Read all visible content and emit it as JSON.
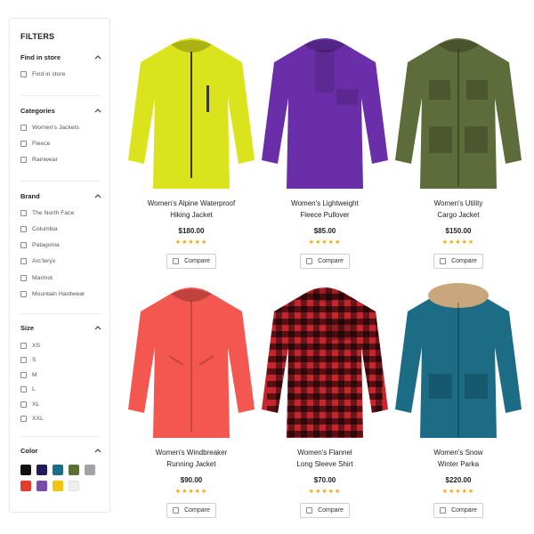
{
  "filters": {
    "title": "FILTERS",
    "find_in_store": {
      "title": "Find in store",
      "options": [
        "Find in store"
      ]
    },
    "categories": {
      "title": "Categories",
      "options": [
        "Women's Jackets",
        "Fleece",
        "Rainwear"
      ]
    },
    "brand": {
      "title": "Brand",
      "options": [
        "The North Face",
        "Columbia",
        "Patagonia",
        "Arc'teryx",
        "Marmot",
        "Mountain Hardwear"
      ]
    },
    "size": {
      "title": "Size",
      "options": [
        "XS",
        "S",
        "M",
        "L",
        "XL",
        "XXL"
      ]
    },
    "color": {
      "title": "Color",
      "swatches": [
        "#111111",
        "#241a5e",
        "#1a6e84",
        "#5b7133",
        "#a3a3a3",
        "#e53c32",
        "#7a4aa8",
        "#f2c416",
        "#eeeeee"
      ]
    }
  },
  "products": [
    {
      "name_line1": "Women's Alpine Waterproof",
      "name_line2": "Hiking Jacket",
      "price": "$180.00",
      "stars": "★★★★★",
      "compare_label": "Compare",
      "color": "#dbe31c"
    },
    {
      "name_line1": "Women's Lightweight",
      "name_line2": "Fleece Pullover",
      "price": "$85.00",
      "stars": "★★★★★",
      "compare_label": "Compare",
      "color": "#6a2fa8"
    },
    {
      "name_line1": "Women's Utility",
      "name_line2": "Cargo Jacket",
      "price": "$150.00",
      "stars": "★★★★★",
      "compare_label": "Compare",
      "color": "#5e6b3a"
    },
    {
      "name_line1": "Women's Windbreaker",
      "name_line2": "Running Jacket",
      "price": "$90.00",
      "stars": "★★★★★",
      "compare_label": "Compare",
      "color": "#f4574f"
    },
    {
      "name_line1": "Women's Flannel",
      "name_line2": "Long Sleeve Shirt",
      "price": "$70.00",
      "stars": "★★★★★",
      "compare_label": "Compare",
      "color": "#c8242b"
    },
    {
      "name_line1": "Women's Snow",
      "name_line2": "Winter Parka",
      "price": "$220.00",
      "stars": "★★★★★",
      "compare_label": "Compare",
      "color": "#1c6c86"
    }
  ]
}
